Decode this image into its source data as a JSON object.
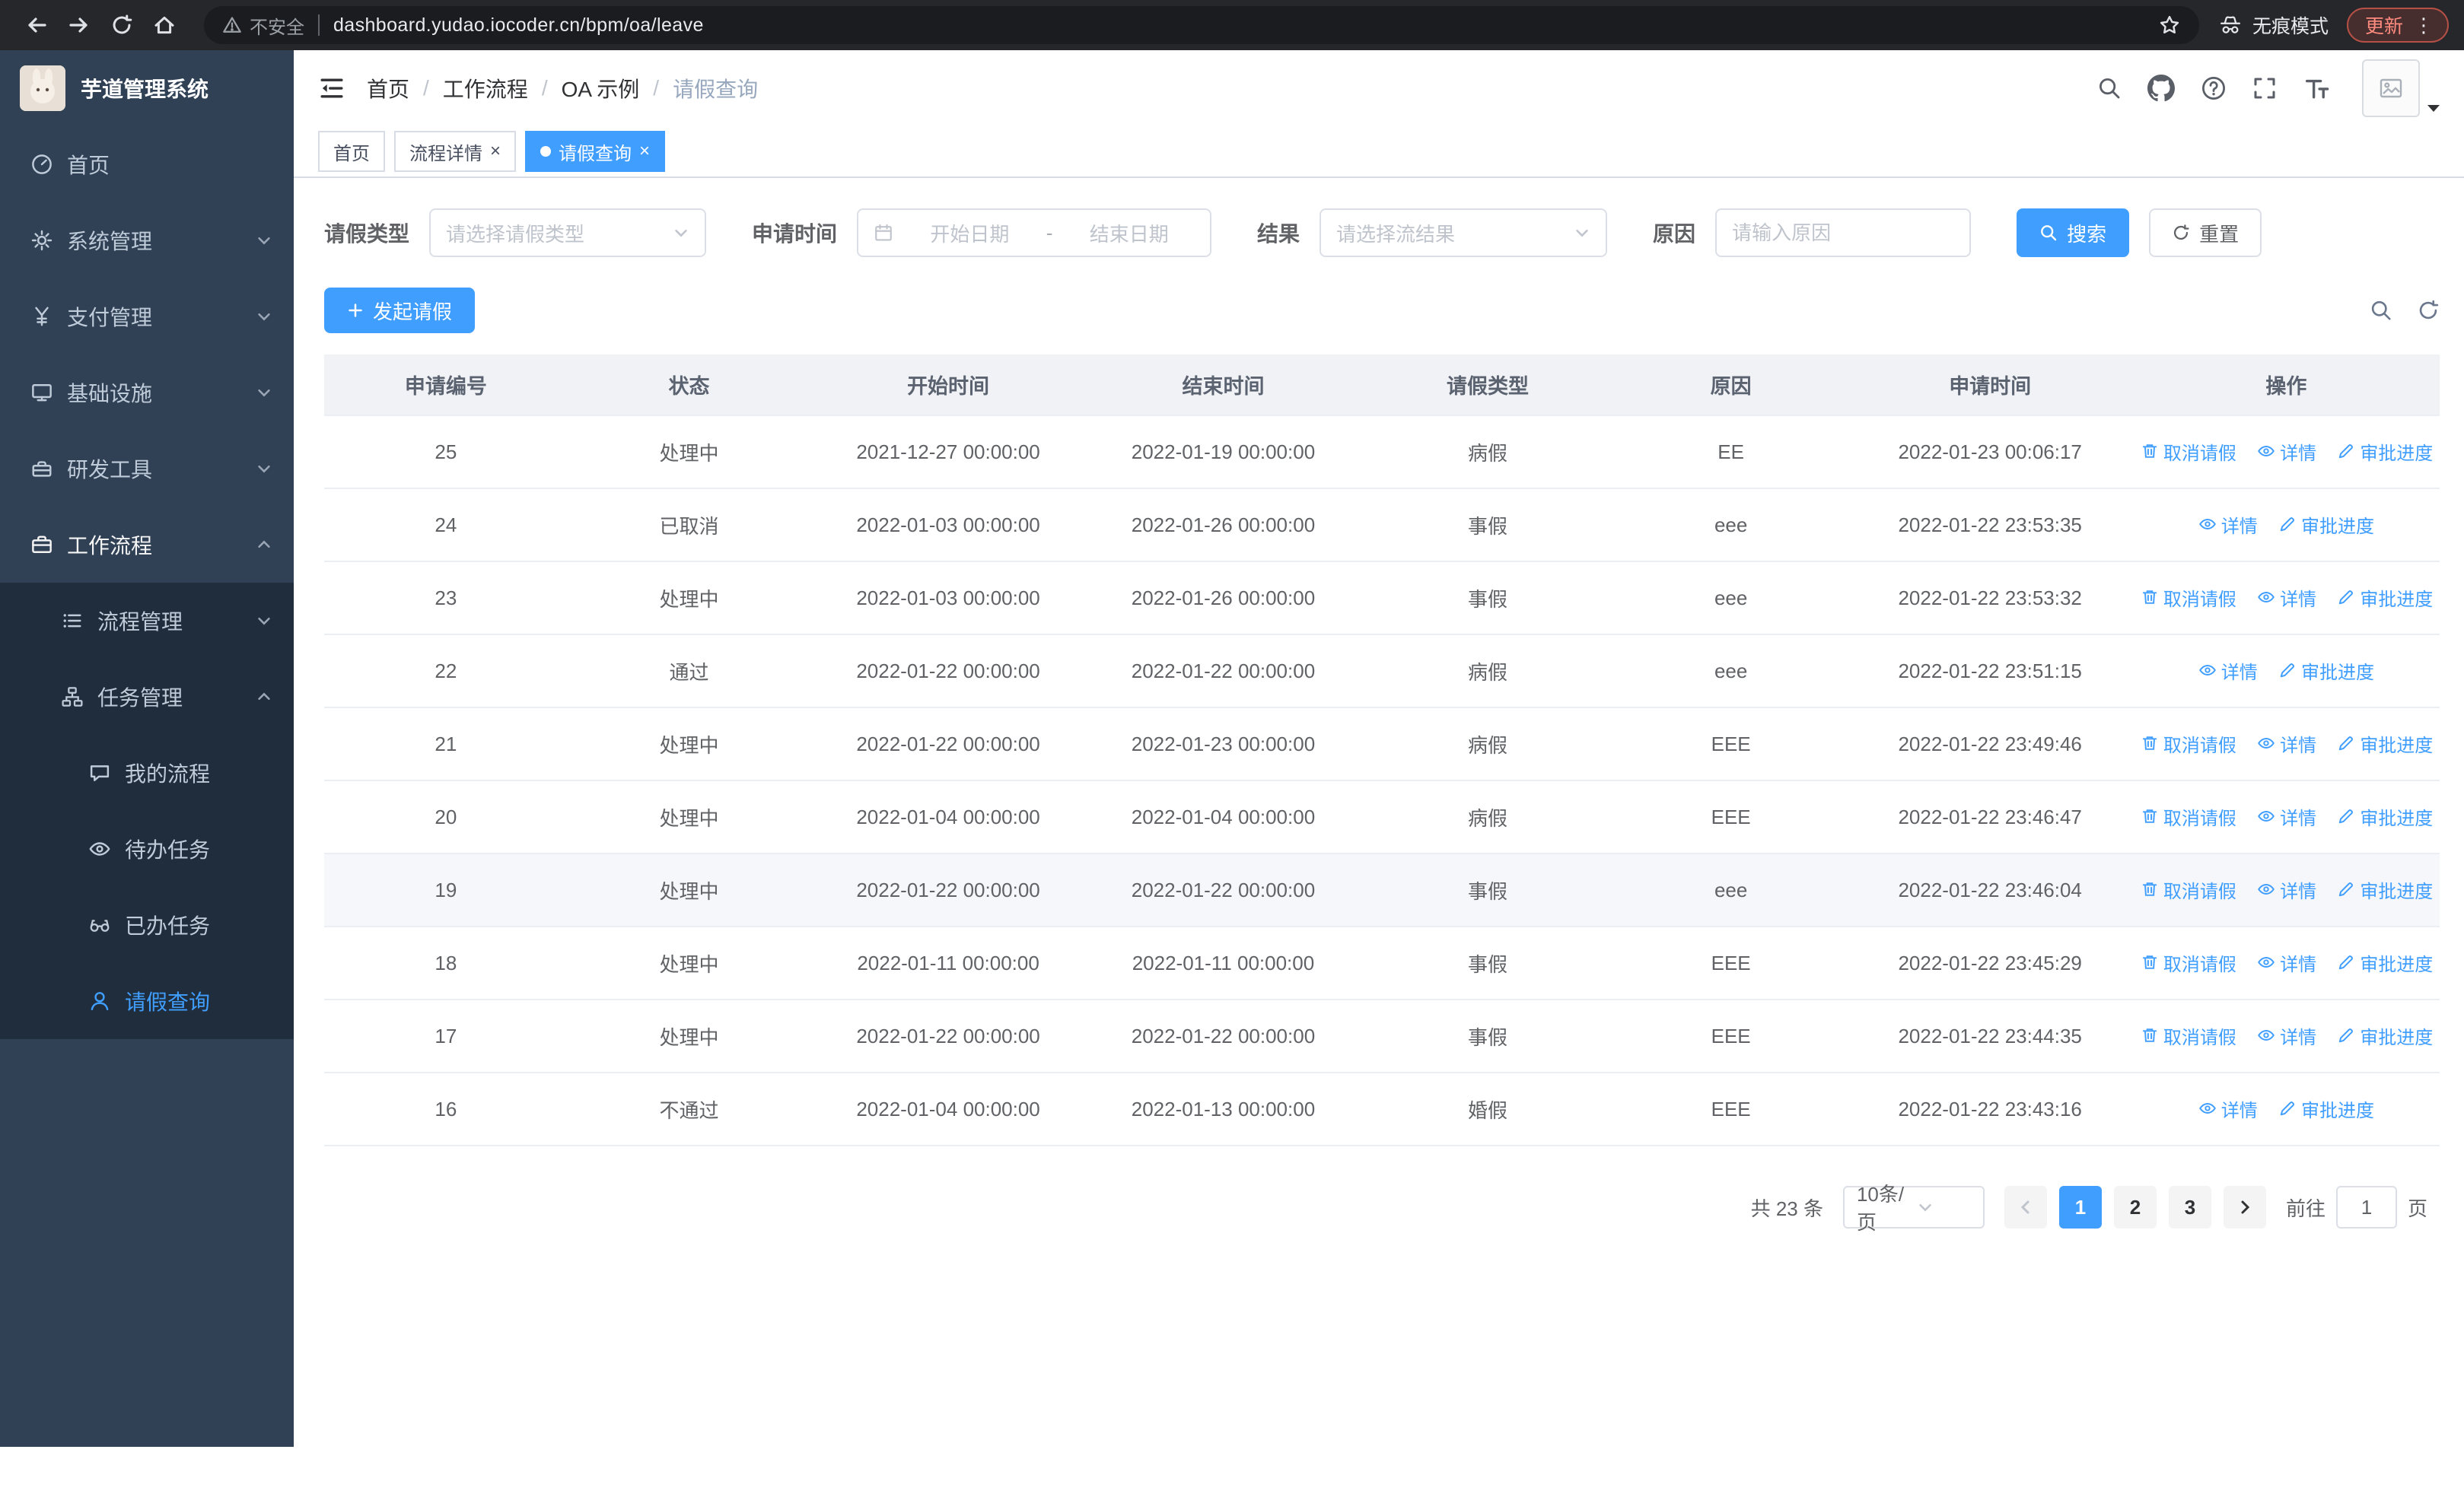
{
  "theme": {
    "accent": "#409eff",
    "sidebar_bg": "#304156",
    "submenu_bg": "#1f2d3d",
    "table_header_bg": "#f0f2f5"
  },
  "browser": {
    "security_warning": "不安全",
    "url": "dashboard.yudao.iocoder.cn/bpm/oa/leave",
    "incognito_label": "无痕模式",
    "update_label": "更新"
  },
  "sidebar": {
    "app_title": "芋道管理系统",
    "items": [
      {
        "label": "首页",
        "icon": "dashboard-icon",
        "level": 1
      },
      {
        "label": "系统管理",
        "icon": "gear-icon",
        "level": 1,
        "expanded": false
      },
      {
        "label": "支付管理",
        "icon": "yen-icon",
        "level": 1,
        "expanded": false
      },
      {
        "label": "基础设施",
        "icon": "monitor-icon",
        "level": 1,
        "expanded": false
      },
      {
        "label": "研发工具",
        "icon": "toolbox-icon",
        "level": 1,
        "expanded": false
      },
      {
        "label": "工作流程",
        "icon": "briefcase-icon",
        "level": 1,
        "expanded": true
      },
      {
        "label": "流程管理",
        "icon": "list-icon",
        "level": 2,
        "expanded": false
      },
      {
        "label": "任务管理",
        "icon": "org-icon",
        "level": 2,
        "expanded": true
      },
      {
        "label": "我的流程",
        "icon": "chat-icon",
        "level": 3
      },
      {
        "label": "待办任务",
        "icon": "eye-icon",
        "level": 3
      },
      {
        "label": "已办任务",
        "icon": "glasses-icon",
        "level": 3
      },
      {
        "label": "请假查询",
        "icon": "user-icon",
        "level": 3,
        "active": true
      }
    ]
  },
  "header": {
    "breadcrumb": [
      "首页",
      "工作流程",
      "OA 示例",
      "请假查询"
    ]
  },
  "tabs": {
    "items": [
      {
        "label": "首页",
        "active": false,
        "closable": false
      },
      {
        "label": "流程详情",
        "active": false,
        "closable": true
      },
      {
        "label": "请假查询",
        "active": true,
        "closable": true
      }
    ]
  },
  "filters": {
    "leave_type_label": "请假类型",
    "leave_type_placeholder": "请选择请假类型",
    "apply_time_label": "申请时间",
    "start_date_placeholder": "开始日期",
    "range_separator": "-",
    "end_date_placeholder": "结束日期",
    "result_label": "结果",
    "result_placeholder": "请选择流结果",
    "reason_label": "原因",
    "reason_placeholder": "请输入原因",
    "search_label": "搜索",
    "reset_label": "重置"
  },
  "toolbar": {
    "create_label": "发起请假"
  },
  "table": {
    "columns": [
      "申请编号",
      "状态",
      "开始时间",
      "结束时间",
      "请假类型",
      "原因",
      "申请时间",
      "操作"
    ],
    "actions": {
      "cancel": "取消请假",
      "detail": "详情",
      "progress": "审批进度"
    },
    "rows": [
      {
        "id": "25",
        "status": "处理中",
        "start": "2021-12-27 00:00:00",
        "end": "2022-01-19 00:00:00",
        "type": "病假",
        "reason": "EE",
        "apply_time": "2022-01-23 00:06:17",
        "can_cancel": true
      },
      {
        "id": "24",
        "status": "已取消",
        "start": "2022-01-03 00:00:00",
        "end": "2022-01-26 00:00:00",
        "type": "事假",
        "reason": "eee",
        "apply_time": "2022-01-22 23:53:35",
        "can_cancel": false
      },
      {
        "id": "23",
        "status": "处理中",
        "start": "2022-01-03 00:00:00",
        "end": "2022-01-26 00:00:00",
        "type": "事假",
        "reason": "eee",
        "apply_time": "2022-01-22 23:53:32",
        "can_cancel": true
      },
      {
        "id": "22",
        "status": "通过",
        "start": "2022-01-22 00:00:00",
        "end": "2022-01-22 00:00:00",
        "type": "病假",
        "reason": "eee",
        "apply_time": "2022-01-22 23:51:15",
        "can_cancel": false
      },
      {
        "id": "21",
        "status": "处理中",
        "start": "2022-01-22 00:00:00",
        "end": "2022-01-23 00:00:00",
        "type": "病假",
        "reason": "EEE",
        "apply_time": "2022-01-22 23:49:46",
        "can_cancel": true
      },
      {
        "id": "20",
        "status": "处理中",
        "start": "2022-01-04 00:00:00",
        "end": "2022-01-04 00:00:00",
        "type": "病假",
        "reason": "EEE",
        "apply_time": "2022-01-22 23:46:47",
        "can_cancel": true
      },
      {
        "id": "19",
        "status": "处理中",
        "start": "2022-01-22 00:00:00",
        "end": "2022-01-22 00:00:00",
        "type": "事假",
        "reason": "eee",
        "apply_time": "2022-01-22 23:46:04",
        "can_cancel": true
      },
      {
        "id": "18",
        "status": "处理中",
        "start": "2022-01-11 00:00:00",
        "end": "2022-01-11 00:00:00",
        "type": "事假",
        "reason": "EEE",
        "apply_time": "2022-01-22 23:45:29",
        "can_cancel": true
      },
      {
        "id": "17",
        "status": "处理中",
        "start": "2022-01-22 00:00:00",
        "end": "2022-01-22 00:00:00",
        "type": "事假",
        "reason": "EEE",
        "apply_time": "2022-01-22 23:44:35",
        "can_cancel": true
      },
      {
        "id": "16",
        "status": "不通过",
        "start": "2022-01-04 00:00:00",
        "end": "2022-01-13 00:00:00",
        "type": "婚假",
        "reason": "EEE",
        "apply_time": "2022-01-22 23:43:16",
        "can_cancel": false
      }
    ]
  },
  "pagination": {
    "total_label": "共 23 条",
    "page_size": "10条/页",
    "pages": [
      "1",
      "2",
      "3"
    ],
    "active_page": "1",
    "goto_label": "前往",
    "goto_value": "1",
    "page_suffix_label": "页"
  }
}
